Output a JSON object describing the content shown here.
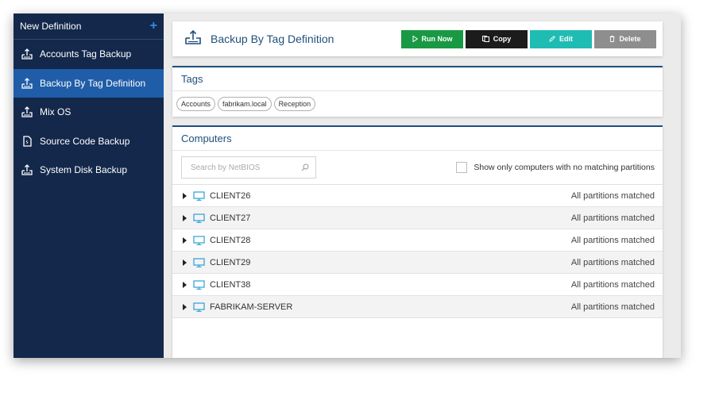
{
  "sidebar": {
    "header": "New Definition",
    "items": [
      {
        "label": "Accounts Tag Backup",
        "icon": "backup-icon",
        "active": false
      },
      {
        "label": "Backup By Tag Definition",
        "icon": "backup-icon",
        "active": true
      },
      {
        "label": "Mix OS",
        "icon": "backup-icon",
        "active": false
      },
      {
        "label": "Source Code Backup",
        "icon": "file-backup-icon",
        "active": false
      },
      {
        "label": "System Disk Backup",
        "icon": "backup-icon",
        "active": false
      }
    ]
  },
  "header": {
    "title": "Backup By Tag Definition",
    "buttons": {
      "run": "Run Now",
      "copy": "Copy",
      "edit": "Edit",
      "delete": "Delete"
    }
  },
  "tags": {
    "title": "Tags",
    "items": [
      "Accounts",
      "fabrikam.local",
      "Reception"
    ]
  },
  "computers": {
    "title": "Computers",
    "search_placeholder": "Search by NetBIOS",
    "checkbox_label": "Show only computers with no matching partitions",
    "rows": [
      {
        "name": "CLIENT26",
        "status": "All partitions matched"
      },
      {
        "name": "CLIENT27",
        "status": "All partitions matched"
      },
      {
        "name": "CLIENT28",
        "status": "All partitions matched"
      },
      {
        "name": "CLIENT29",
        "status": "All partitions matched"
      },
      {
        "name": "CLIENT38",
        "status": "All partitions matched"
      },
      {
        "name": "FABRIKAM-SERVER",
        "status": "All partitions matched"
      }
    ]
  },
  "colors": {
    "sidebar": "#14284b",
    "active": "#1f5da8",
    "accent": "#1f4f7d",
    "run": "#199944",
    "edit": "#1fbcb4",
    "delete": "#8e8e8e"
  }
}
